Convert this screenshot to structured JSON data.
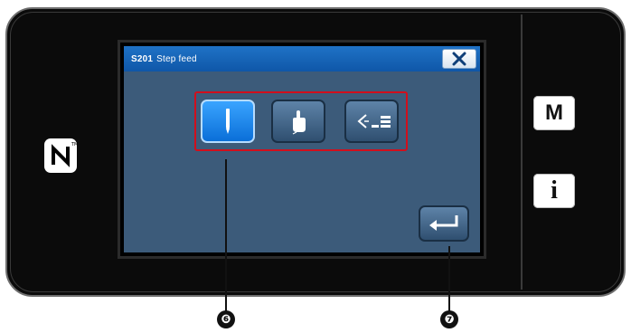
{
  "dialog": {
    "code": "S201",
    "title": "Step feed",
    "close_icon": "close-x-icon"
  },
  "modes": [
    {
      "name": "needle",
      "icon": "needle-icon",
      "selected": true
    },
    {
      "name": "hand",
      "icon": "pointing-hand-icon",
      "selected": false
    },
    {
      "name": "presser",
      "icon": "presser-foot-icon",
      "selected": false
    }
  ],
  "enter_icon": "enter-return-icon",
  "side_buttons": {
    "menu_label": "M",
    "info_label": "i"
  },
  "callouts": {
    "first": "❻",
    "second": "❼"
  },
  "colors": {
    "title_bar": "#0f57a8",
    "selected_button": "#0a6fd8",
    "highlight_box": "#d10f1c"
  }
}
